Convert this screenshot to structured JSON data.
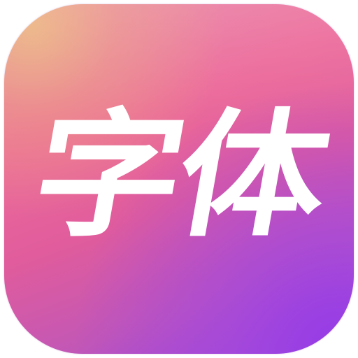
{
  "icon": {
    "title": "字体",
    "colors": {
      "top_left": "#e8b07e",
      "middle": "#ec6a9a",
      "bottom_right": "#9b44dc",
      "text": "#ffffff"
    }
  }
}
